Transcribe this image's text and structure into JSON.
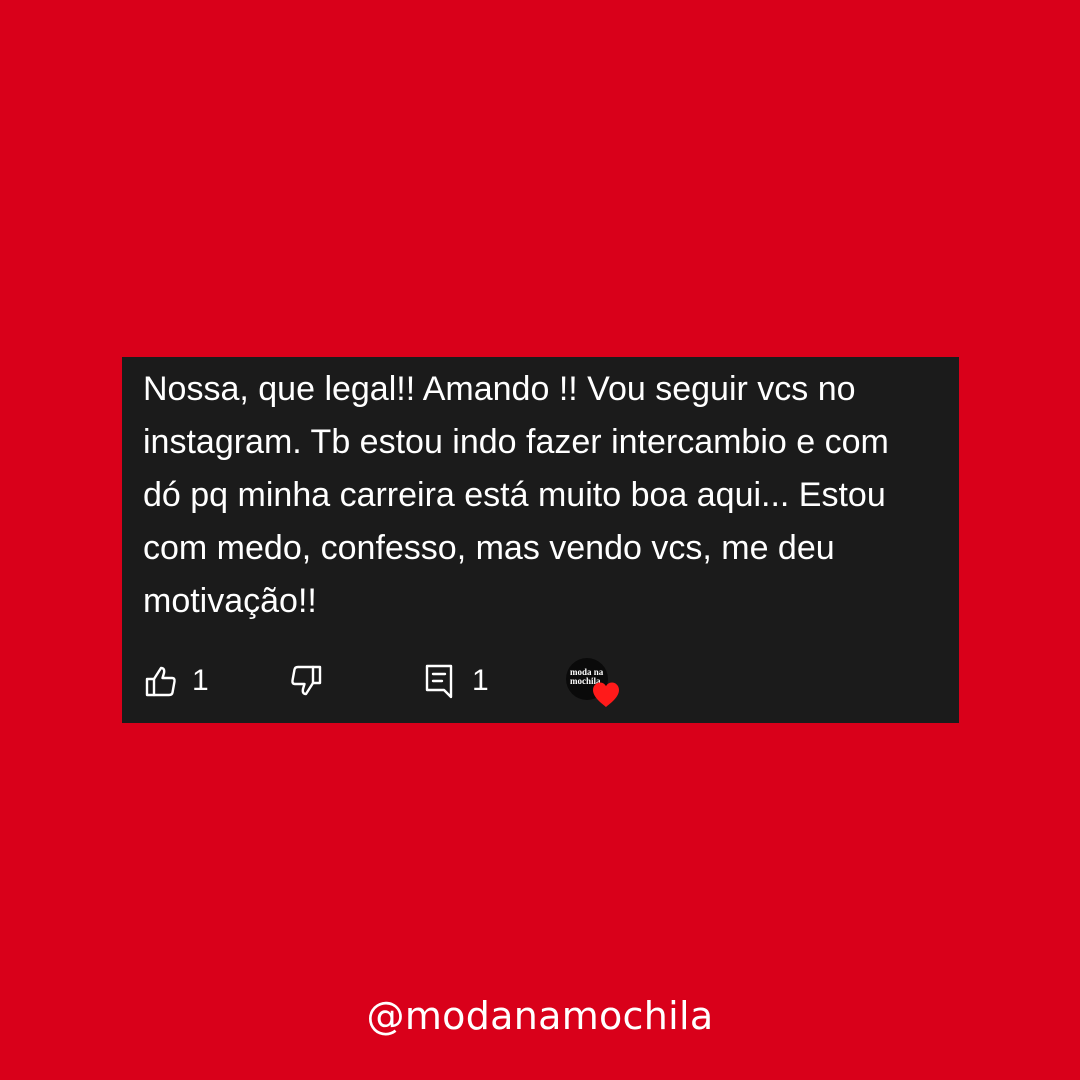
{
  "comment": {
    "lines": [
      "Nossa, que legal!! Amando !! Vou seguir vcs no",
      "instagram. Tb estou indo fazer intercambio e com",
      "dó pq minha carreira está muito boa aqui... Estou",
      "com medo, confesso, mas vendo vcs, me deu",
      "motivação!!"
    ],
    "like_count": "1",
    "reply_count": "1",
    "creator_avatar_text": "moda na mochila",
    "creator_heart": true
  },
  "footer": {
    "handle": "@modanamochila"
  },
  "colors": {
    "background": "#d9001a",
    "card": "#1b1b1b",
    "text": "#ffffff",
    "heart": "#ff1a1a"
  },
  "icons": {
    "like": "thumbs-up-icon",
    "dislike": "thumbs-down-icon",
    "reply": "comment-icon",
    "heart": "heart-icon"
  }
}
